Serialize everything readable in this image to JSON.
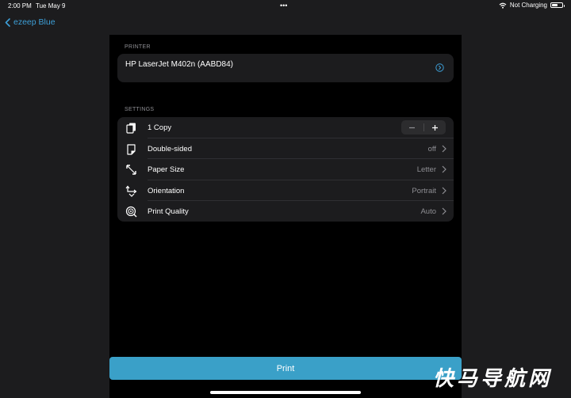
{
  "status_bar": {
    "time": "2:00 PM",
    "date": "Tue May 9",
    "multitask_dots": "•••",
    "battery_status": "Not Charging",
    "battery_level_percent": 60
  },
  "nav": {
    "back_label": "ezeep Blue"
  },
  "printer_section": {
    "header": "PRINTER",
    "printer_name": "HP LaserJet M402n (AABD84)"
  },
  "settings_section": {
    "header": "SETTINGS",
    "rows": [
      {
        "icon": "copies-icon",
        "label": "1 Copy",
        "value": ""
      },
      {
        "icon": "double-sided-icon",
        "label": "Double-sided",
        "value": "off"
      },
      {
        "icon": "paper-size-icon",
        "label": "Paper Size",
        "value": "Letter"
      },
      {
        "icon": "orientation-icon",
        "label": "Orientation",
        "value": "Portrait"
      },
      {
        "icon": "print-quality-icon",
        "label": "Print Quality",
        "value": "Auto"
      }
    ]
  },
  "print_button": {
    "label": "Print"
  },
  "watermark": "快马导航网",
  "colors": {
    "accent": "#3d9fd8",
    "print_button": "#3aa0c8",
    "card_background": "#1c1c1e",
    "sheet_background": "#000000",
    "secondary_text": "#8e8e93"
  }
}
